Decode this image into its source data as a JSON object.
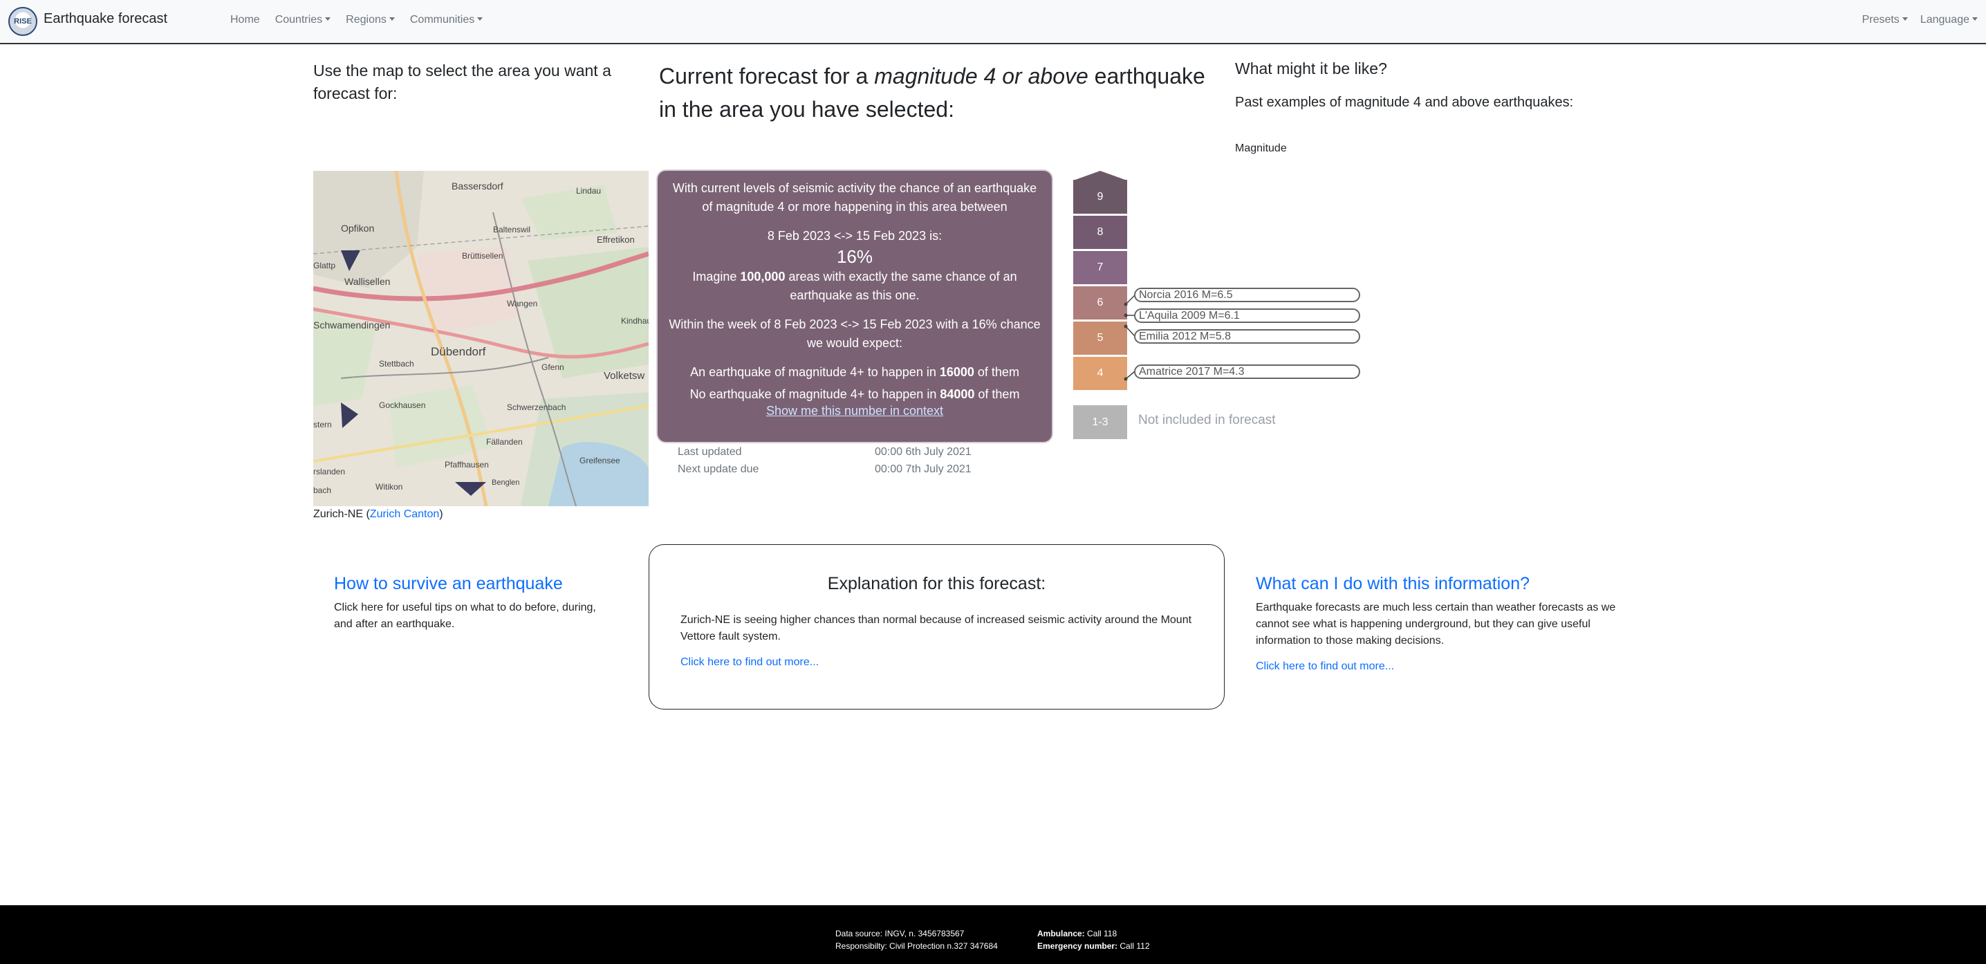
{
  "nav": {
    "logo_text": "RISE",
    "brand": "Earthquake forecast",
    "items": [
      {
        "label": "Home",
        "dropdown": false
      },
      {
        "label": "Countries",
        "dropdown": true
      },
      {
        "label": "Regions",
        "dropdown": true
      },
      {
        "label": "Communities",
        "dropdown": true
      }
    ],
    "right": [
      {
        "label": "Presets",
        "dropdown": true
      },
      {
        "label": "Language",
        "dropdown": true
      }
    ]
  },
  "left": {
    "heading": "Use the map to select the area you want a forecast for:",
    "map_places": [
      "Bassersdorf",
      "Lindau",
      "Opfikon",
      "Baltenswil",
      "Effretikon",
      "Brüttisellen",
      "Wallisellen",
      "Wangen",
      "Kindhausen",
      "Schwamendingen",
      "Dübendorf",
      "Gfenn",
      "Stettbach",
      "Volketsw",
      "Gockhausen",
      "Schwerzenbach",
      "Fällanden",
      "Pfaffhausen",
      "Greifensee",
      "Witikon",
      "Benglen",
      "Glattp",
      "stern",
      "rslanden",
      "bach"
    ],
    "area": "Zurich-NE",
    "canton": "Zurich Canton"
  },
  "forecast": {
    "heading_pre": "Current forecast for a ",
    "heading_em": "magnitude 4 or above",
    "heading_post": " earthquake in the area you have selected:",
    "p1": "With current levels of seismic activity the chance of an earthquake of magnitude 4 or more happening in this area between",
    "dates": "8 Feb 2023 <-> 15 Feb 2023 is:",
    "percent": "16%",
    "imagine_pre": "Imagine ",
    "imagine_num": "100,000",
    "imagine_post": " areas with exactly the same chance of an earthquake as this one.",
    "within": "Within the week of 8 Feb 2023 <-> 15 Feb 2023 with a 16% chance we would expect:",
    "yes_pre": "An earthquake of magnitude 4+ to happen in ",
    "yes_num": "16000",
    "yes_post": " of them",
    "no_pre": "No earthquake of magnitude 4+ to happen in ",
    "no_num": "84000",
    "no_post": " of them",
    "context_link": "Show me this number in context",
    "last_updated_label": "Last updated",
    "last_updated": "00:00 6th July 2021",
    "next_update_label": "Next update due",
    "next_update": "00:00 7th July 2021"
  },
  "examples": {
    "heading": "What might it be like?",
    "subheading": "Past examples of magnitude 4 and above earthquakes:",
    "magnitude_label": "Magnitude",
    "scale": [
      "9",
      "8",
      "7",
      "6",
      "5",
      "4"
    ],
    "scale_colors": [
      "#6b5866",
      "#735a70",
      "#866784",
      "#ad7d7c",
      "#c98e6f",
      "#e0a06f"
    ],
    "low_cell": "1-3",
    "low_color": "#b5b5b5",
    "not_included": "Not included in forecast",
    "quakes": [
      {
        "label": "Norcia 2016 M=6.5"
      },
      {
        "label": "L'Aquila 2009 M=6.1"
      },
      {
        "label": "Emilia 2012 M=5.8"
      },
      {
        "label": "Amatrice 2017 M=4.3"
      }
    ]
  },
  "cards": {
    "survive_title": "How to survive an earthquake",
    "survive_text": "Click here for useful tips on what to do before, during, and after an earthquake.",
    "explanation_title": "Explanation for this forecast:",
    "explanation_text": "Zurich-NE is seeing higher chances than normal because of increased seismic activity around the Mount Vettore fault system.",
    "explanation_link": "Click here to find out more...",
    "info_title": "What can I do with this information?",
    "info_text": "Earthquake forecasts are much less certain than weather forecasts as we cannot see what is happening underground, but they can give useful information to those making decisions.",
    "info_link": "Click here to find out more..."
  },
  "footer": {
    "data_source": "Data source: INGV, n. 3456783567",
    "responsibility": "Responsibilty: Civil Protection n.327 347684",
    "ambulance_label": "Ambulance:",
    "ambulance": " Call 118",
    "emergency_label": "Emergency number:",
    "emergency": " Call 112"
  }
}
